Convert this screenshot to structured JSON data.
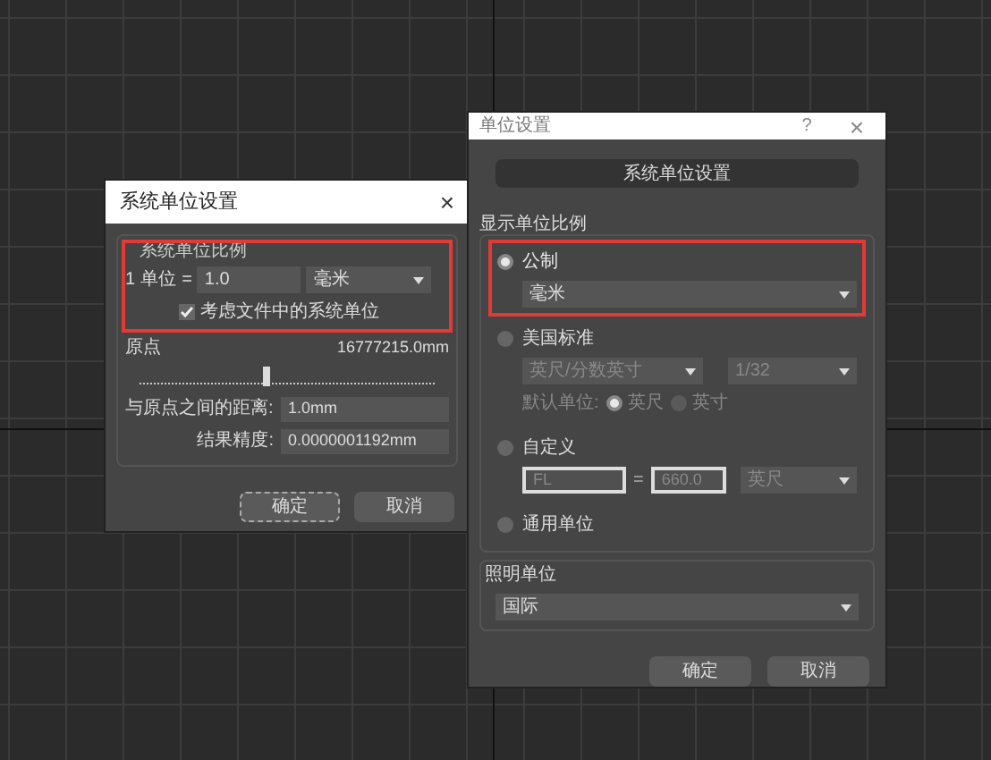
{
  "left_dialog": {
    "title": "系统单位设置",
    "close": "×",
    "group_title": "系统单位比例",
    "highlighted": true,
    "prefix": "1",
    "unit_label": "单位",
    "equals": "=",
    "scale_value": "1.0",
    "unit_select": "毫米",
    "checkbox": {
      "label": "考虑文件中的系统单位",
      "checked": true
    },
    "origin_label": "原点",
    "origin_value": "16777215.0mm",
    "origin_slider": {
      "level": 0.42
    },
    "distance_label": "与原点之间的距离:",
    "distance_value": "1.0mm",
    "precision_label": "结果精度:",
    "precision_value": "0.0000001192mm",
    "buttons": [
      {
        "label": "确定",
        "focused": true
      },
      {
        "label": "取消",
        "focused": false
      }
    ]
  },
  "right_dialog": {
    "title": "单位设置",
    "help": "?",
    "close": "×",
    "header_button": "系统单位设置",
    "section_title": "显示单位比例",
    "options": [
      {
        "kind": "metric",
        "label": "公制",
        "selected": true,
        "highlighted": true,
        "select": "毫米"
      },
      {
        "kind": "us",
        "label": "美国标准",
        "selected": false,
        "highlighted": false,
        "select": "英尺/分数英寸",
        "select2": "1/32",
        "default_label": "默认单位:",
        "radios": [
          {
            "label": "英尺",
            "selected": true
          },
          {
            "label": "英寸",
            "selected": false
          }
        ]
      },
      {
        "kind": "custom",
        "label": "自定义",
        "selected": false,
        "highlighted": false,
        "field1": "FL",
        "equals": "=",
        "field2": "660.0",
        "select": "英尺"
      },
      {
        "kind": "generic",
        "label": "通用单位",
        "selected": false,
        "highlighted": false
      }
    ],
    "lighting_title": "照明单位",
    "lighting_select": "国际",
    "buttons": [
      {
        "label": "确定",
        "focused": false
      },
      {
        "label": "取消",
        "focused": false
      }
    ]
  }
}
